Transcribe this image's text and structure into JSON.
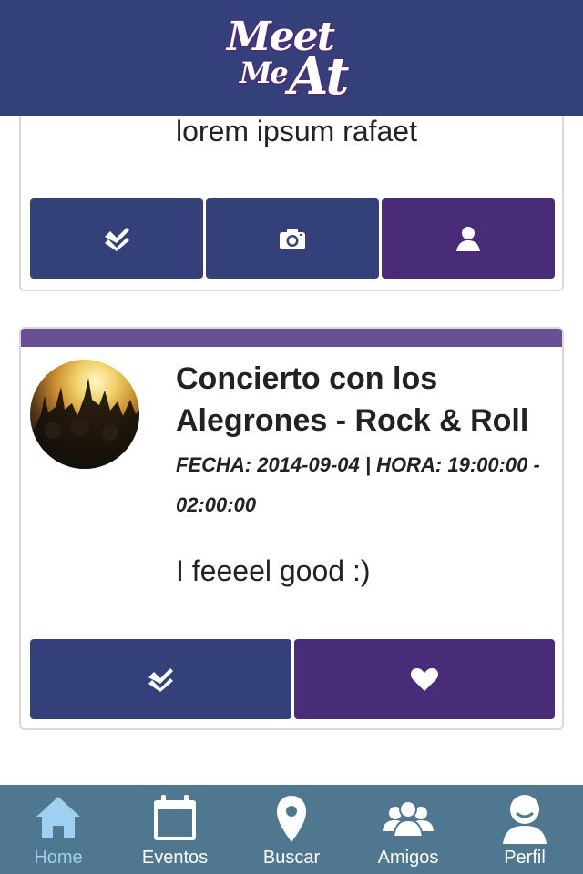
{
  "app": {
    "logo_line1": "Meet",
    "logo_line2": "Me",
    "logo_line3": "At"
  },
  "colors": {
    "header": "#33407a",
    "button_blue": "#33407a",
    "button_purple": "#482c78",
    "card_accent": "#6a4f96",
    "tabbar": "#4f7890",
    "tab_active": "#9fd0ef"
  },
  "cards": [
    {
      "text": "lorem ipsum rafaet",
      "actions": [
        {
          "icon": "checkin-icon"
        },
        {
          "icon": "camera-icon"
        },
        {
          "icon": "person-icon"
        }
      ]
    },
    {
      "title": "Concierto con los Alegrones - Rock & Roll",
      "meta": "FECHA: 2014-09-04 | HORA: 19:00:00 - 02:00:00",
      "description": "I feeeel good :)",
      "actions": [
        {
          "icon": "checkin-icon"
        },
        {
          "icon": "heart-icon"
        }
      ]
    }
  ],
  "tabbar": {
    "active": "Home",
    "tabs": [
      {
        "label": "Home",
        "icon": "home-icon"
      },
      {
        "label": "Eventos",
        "icon": "calendar-icon"
      },
      {
        "label": "Buscar",
        "icon": "location-pin-icon"
      },
      {
        "label": "Amigos",
        "icon": "friends-icon"
      },
      {
        "label": "Perfil",
        "icon": "profile-icon"
      }
    ]
  }
}
